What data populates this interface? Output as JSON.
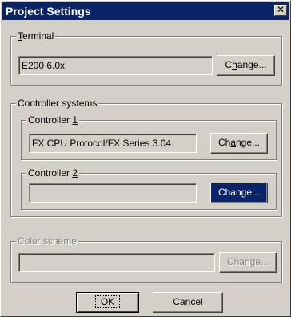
{
  "window": {
    "title": "Project Settings",
    "close_glyph": "✕"
  },
  "terminal": {
    "label_first": "T",
    "label_rest": "erminal",
    "value": "E200 6.0x",
    "change_pre": "C",
    "change_under": "h",
    "change_post": "ange..."
  },
  "controller_systems": {
    "label": "Controller systems",
    "controller1": {
      "label_pre": "Controller ",
      "label_under": "1",
      "value": "FX CPU Protocol/FX Series 3.04.",
      "change_pre": "Ch",
      "change_under": "a",
      "change_post": "nge..."
    },
    "controller2": {
      "label_pre": "Controller ",
      "label_under": "2",
      "value": "",
      "change_label": "Change..."
    }
  },
  "color_scheme": {
    "label": "Color scheme",
    "value": "",
    "change_label": "Change..."
  },
  "buttons": {
    "ok": "OK",
    "cancel": "Cancel"
  },
  "colors": {
    "titlebar": "#0a246a",
    "face": "#d4d0c8",
    "highlight": "#0a246a"
  }
}
